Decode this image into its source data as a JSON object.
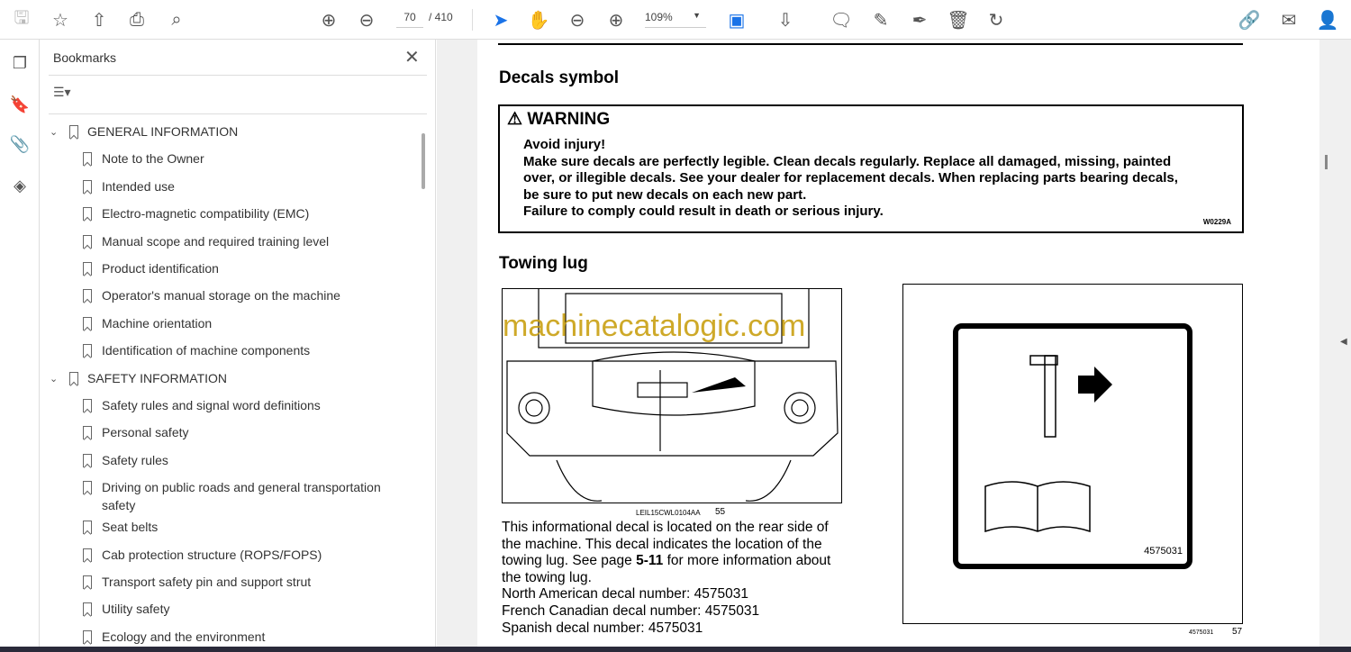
{
  "toolbar": {
    "page_current": "70",
    "page_total": "/ 410",
    "zoom": "109%"
  },
  "bookmarks": {
    "title": "Bookmarks",
    "items": [
      {
        "label": "GENERAL INFORMATION",
        "level": 0
      },
      {
        "label": "Note to the Owner",
        "level": 1
      },
      {
        "label": "Intended use",
        "level": 1
      },
      {
        "label": "Electro-magnetic compatibility (EMC)",
        "level": 1
      },
      {
        "label": "Manual scope and required training level",
        "level": 1
      },
      {
        "label": "Product identification",
        "level": 1
      },
      {
        "label": "Operator's manual storage on the machine",
        "level": 1
      },
      {
        "label": "Machine orientation",
        "level": 1
      },
      {
        "label": "Identification of machine components",
        "level": 1
      },
      {
        "label": "SAFETY INFORMATION",
        "level": 0
      },
      {
        "label": "Safety rules and signal word definitions",
        "level": 1
      },
      {
        "label": "Personal safety",
        "level": 1
      },
      {
        "label": "Safety rules",
        "level": 1
      },
      {
        "label": "Driving on public roads and general transportation safety",
        "level": 1
      },
      {
        "label": "Seat belts",
        "level": 1
      },
      {
        "label": "Cab protection structure (ROPS/FOPS)",
        "level": 1
      },
      {
        "label": "Transport safety pin and support strut",
        "level": 1
      },
      {
        "label": "Utility safety",
        "level": 1
      },
      {
        "label": "Ecology and the environment",
        "level": 1
      }
    ]
  },
  "doc": {
    "heading1": "Decals symbol",
    "warning_title": "WARNING",
    "warning_lines": [
      "Avoid injury!",
      "Make sure decals are perfectly legible. Clean decals regularly. Replace all damaged, missing, painted",
      "over, or illegible decals. See your dealer for replacement decals. When replacing parts bearing decals,",
      "be sure to put new decals on each new part.",
      "Failure to comply could result in death or serious injury."
    ],
    "warning_code": "W0229A",
    "heading2": "Towing lug",
    "watermark": "machinecatalogic.com",
    "fig1_caption": "LEIL15CWL0104AA",
    "fig1_num": "55",
    "fig2_decal": "4575031",
    "fig2_caption": "4575031",
    "fig2_num": "57",
    "para_a": "This informational decal is located on the rear side of",
    "para_b": "the machine. This decal indicates the location of the",
    "para_c1": "towing lug. See page ",
    "para_c_ref": "5-11",
    "para_c2": " for more information about",
    "para_d": "the towing lug.",
    "decal_lines": [
      "North American decal number: 4575031",
      "French Canadian decal number: 4575031",
      "Spanish decal number: 4575031"
    ]
  }
}
